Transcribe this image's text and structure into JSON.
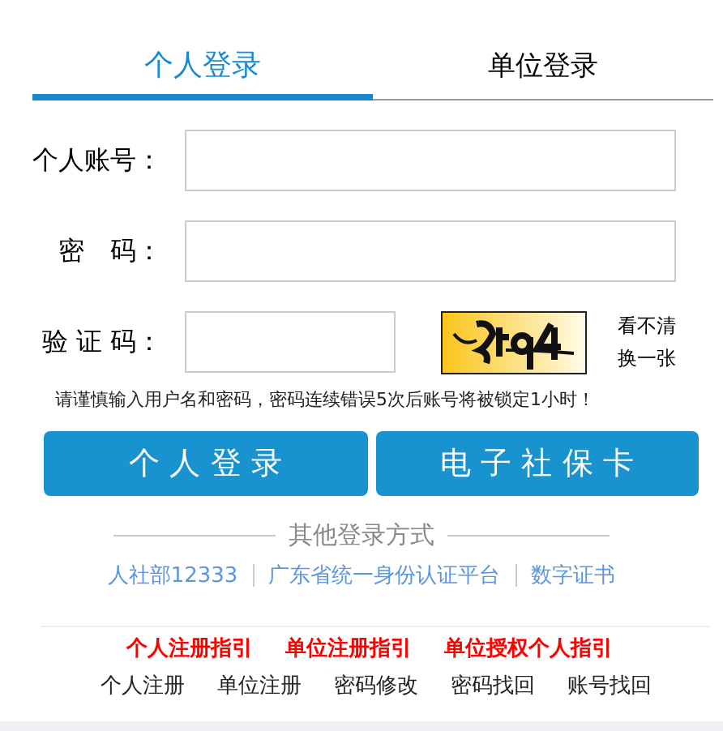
{
  "tabs": [
    {
      "label": "个人登录",
      "selected": true
    },
    {
      "label": "单位登录",
      "selected": false
    }
  ],
  "fields": [
    {
      "label": "个人账号：",
      "kind": "text"
    },
    {
      "label": "密　码：",
      "kind": "password"
    },
    {
      "label": "验 证 码：",
      "kind": "captcha",
      "refresh_lines": [
        "看不清",
        "换一张"
      ]
    }
  ],
  "notice": "请谨慎输入用户名和密码，密码连续错误5次后账号将被锁定1小时！",
  "buttons": [
    "个 人 登 录",
    "电 子 社 保 卡"
  ],
  "other_login": {
    "title": "其他登录方式",
    "links": [
      "人社部12333",
      "广东省统一身份认证平台",
      "数字证书"
    ]
  },
  "guides": [
    "个人注册指引",
    "单位注册指引",
    "单位授权个人指引"
  ],
  "footer_links": [
    "个人注册",
    "单位注册",
    "密码修改",
    "密码找回",
    "账号找回"
  ]
}
